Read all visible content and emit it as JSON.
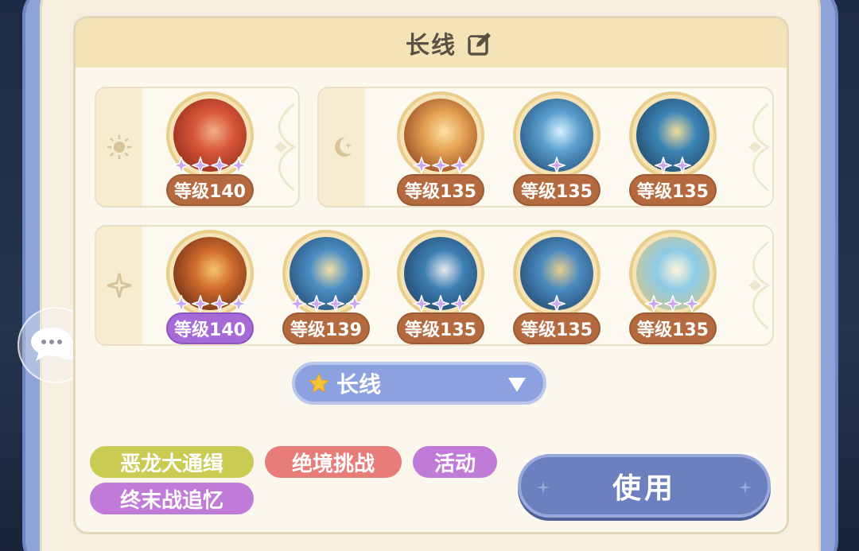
{
  "panel": {
    "title": "长线",
    "edit_icon": "edit-icon"
  },
  "groups": [
    {
      "symbol": "sun-icon",
      "skills": [
        {
          "level": "等级140",
          "stars": 4,
          "pill": "orange",
          "art": "archer-red"
        }
      ]
    },
    {
      "symbol": "moon-icon",
      "skills": [
        {
          "level": "等级135",
          "stars": 3,
          "pill": "orange",
          "art": "flame-burst"
        },
        {
          "level": "等级135",
          "stars": 1,
          "pill": "orange",
          "art": "blue-beam"
        },
        {
          "level": "等级135",
          "stars": 2,
          "pill": "orange",
          "art": "gold-rune"
        }
      ]
    },
    {
      "symbol": "sparkle-icon",
      "skills": [
        {
          "level": "等级140",
          "stars": 4,
          "pill": "purple",
          "art": "flame-bow"
        },
        {
          "level": "等级139",
          "stars": 4,
          "pill": "orange",
          "art": "arrow-rain"
        },
        {
          "level": "等级135",
          "stars": 3,
          "pill": "orange",
          "art": "arrow-dash"
        },
        {
          "level": "等级135",
          "stars": 1,
          "pill": "orange",
          "art": "arrow-quiver"
        },
        {
          "level": "等级135",
          "stars": 3,
          "pill": "orange",
          "art": "beast-howl"
        }
      ]
    }
  ],
  "preset": {
    "label": "长线",
    "icon": "star-icon",
    "arrow": "triangle-down-icon"
  },
  "tags": [
    {
      "label": "恶龙大通缉",
      "color": "#c9cb52"
    },
    {
      "label": "绝境挑战",
      "color": "#e77c78"
    },
    {
      "label": "活动",
      "color": "#c07ad8"
    },
    {
      "label": "终末战追忆",
      "color": "#c07ad8"
    }
  ],
  "use_button": "使用",
  "colors": {
    "frame": "#8ea3d8",
    "header": "#f3e3b6",
    "level_pill": "#b4693e",
    "level_pill_purple": "#a66ad6",
    "star_purple": "#c9a8f2"
  }
}
